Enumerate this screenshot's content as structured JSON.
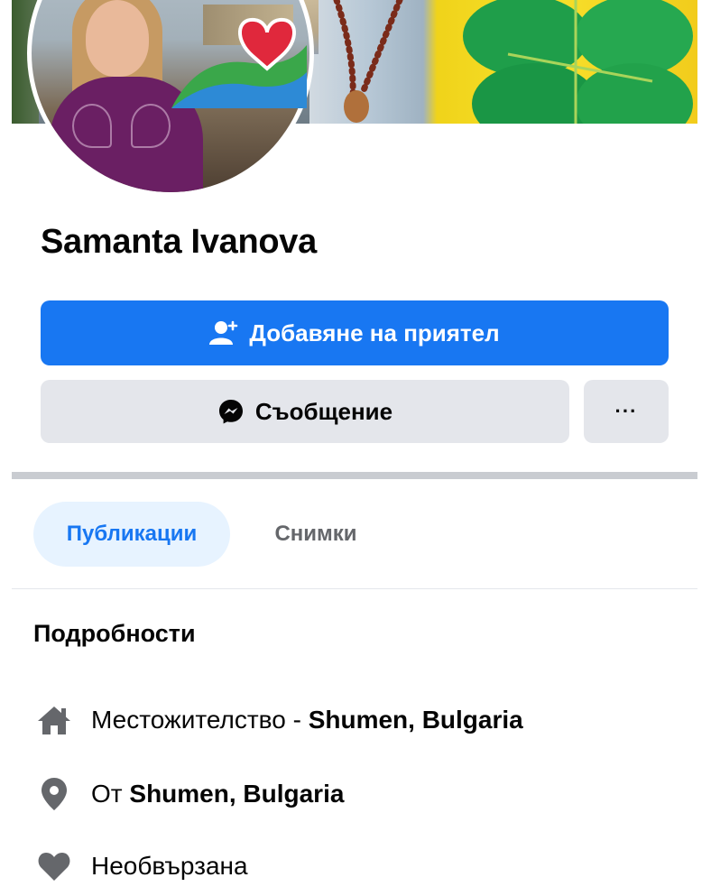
{
  "profile": {
    "name": "Samanta Ivanova"
  },
  "actions": {
    "add_friend_label": "Добавяне на приятел",
    "message_label": "Съобщение",
    "more_label": "···"
  },
  "tabs": [
    {
      "label": "Публикации",
      "active": true
    },
    {
      "label": "Снимки",
      "active": false
    }
  ],
  "details": {
    "title": "Подробности",
    "items": [
      {
        "icon": "home-icon",
        "prefix": "Местожителство - ",
        "value": "Shumen, Bulgaria"
      },
      {
        "icon": "location-pin-icon",
        "prefix": "От ",
        "value": "Shumen, Bulgaria"
      },
      {
        "icon": "heart-icon",
        "prefix": "Необвързана",
        "value": ""
      }
    ]
  },
  "colors": {
    "accent": "#1877f2",
    "button_secondary": "#e4e6eb",
    "tab_active_bg": "#e7f3ff",
    "icon_gray": "#65676b"
  }
}
